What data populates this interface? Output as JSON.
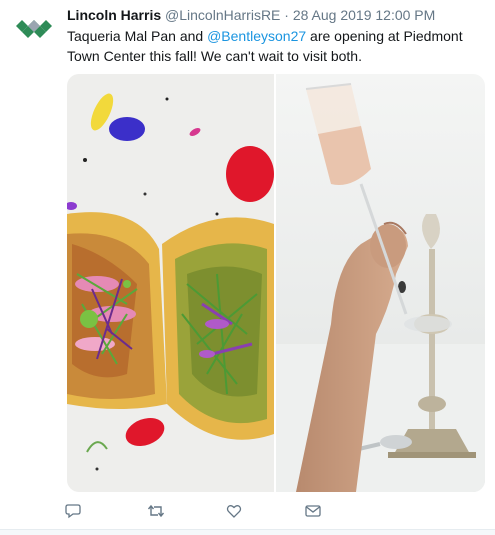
{
  "tweet": {
    "author_name": "Lincoln Harris",
    "handle": "@LincolnHarrisRE",
    "separator": "·",
    "timestamp": "28 Aug 2019 12:00 PM",
    "text_before": "Taqueria Mal Pan and ",
    "mention": "@Bentleyson27",
    "text_after": " are opening at Piedmont Town Center this fall! We can't wait to visit both.",
    "avatar_icon": "lincoln-harris-logo-icon",
    "brand_color": "#2e8b57",
    "text_color": "#14171a",
    "muted_color": "#657786",
    "link_color": "#1b95e0"
  },
  "media": {
    "left_photo": "tacos-photo",
    "right_photo": "champagne-toast-photo"
  },
  "actions": [
    {
      "name": "reply",
      "icon": "reply-icon"
    },
    {
      "name": "retweet",
      "icon": "retweet-icon"
    },
    {
      "name": "like",
      "icon": "heart-icon"
    },
    {
      "name": "message",
      "icon": "envelope-icon"
    }
  ]
}
